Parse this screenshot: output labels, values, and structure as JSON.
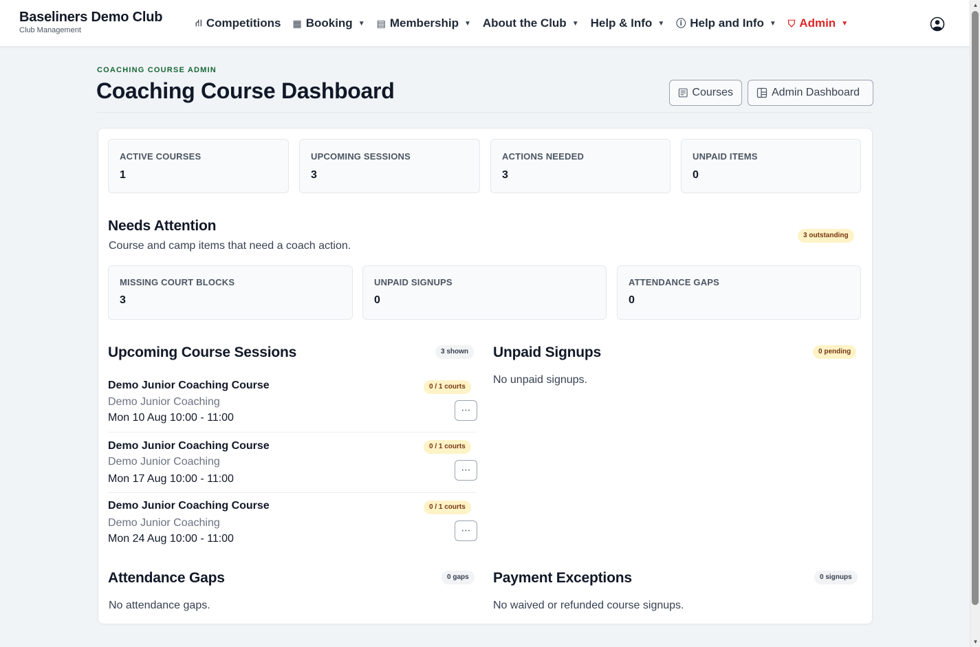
{
  "brand": {
    "name": "Baseliners Demo Club",
    "sub": "Club Management"
  },
  "nav": [
    {
      "label": "Competitions",
      "icon": "sitemap-icon",
      "glyph": "⛙",
      "caret": false
    },
    {
      "label": "Booking",
      "icon": "calendar-icon",
      "glyph": "▦",
      "caret": true
    },
    {
      "label": "Membership",
      "icon": "id-card-icon",
      "glyph": "▤",
      "caret": true
    },
    {
      "label": "About the Club",
      "icon": "",
      "glyph": "",
      "caret": true
    },
    {
      "label": "Help & Info",
      "icon": "",
      "glyph": "",
      "caret": true
    },
    {
      "label": "Help and Info",
      "icon": "info-circle-icon",
      "glyph": "ⓘ",
      "caret": true
    },
    {
      "label": "Admin",
      "icon": "shield-icon",
      "glyph": "⛉",
      "caret": true
    }
  ],
  "colors": {
    "accent_green": "#166534",
    "admin_red": "#dc2626",
    "badge_yellow": "#fef3c7"
  },
  "header": {
    "eyebrow": "COACHING COURSE ADMIN",
    "title": "Coaching Course Dashboard",
    "courses_button": "Courses",
    "admin_dashboard_button": "Admin Dashboard"
  },
  "stats": [
    {
      "label": "ACTIVE COURSES",
      "value": "1"
    },
    {
      "label": "UPCOMING SESSIONS",
      "value": "3"
    },
    {
      "label": "ACTIONS NEEDED",
      "value": "3"
    },
    {
      "label": "UNPAID ITEMS",
      "value": "0"
    }
  ],
  "needs_attention": {
    "title": "Needs Attention",
    "description": "Course and camp items that need a coach action.",
    "badge": "3 outstanding",
    "items": [
      {
        "label": "MISSING COURT BLOCKS",
        "value": "3"
      },
      {
        "label": "UNPAID SIGNUPS",
        "value": "0"
      },
      {
        "label": "ATTENDANCE GAPS",
        "value": "0"
      }
    ]
  },
  "upcoming_sessions": {
    "title": "Upcoming Course Sessions",
    "badge": "3 shown",
    "sessions": [
      {
        "name": "Demo Junior Coaching Course",
        "sub": "Demo Junior Coaching",
        "time": "Mon 10 Aug 10:00 - 11:00",
        "courts": "0 / 1 courts"
      },
      {
        "name": "Demo Junior Coaching Course",
        "sub": "Demo Junior Coaching",
        "time": "Mon 17 Aug 10:00 - 11:00",
        "courts": "0 / 1 courts"
      },
      {
        "name": "Demo Junior Coaching Course",
        "sub": "Demo Junior Coaching",
        "time": "Mon 24 Aug 10:00 - 11:00",
        "courts": "0 / 1 courts"
      }
    ]
  },
  "unpaid_signups": {
    "title": "Unpaid Signups",
    "badge": "0 pending",
    "empty": "No unpaid signups."
  },
  "attendance_gaps": {
    "title": "Attendance Gaps",
    "badge": "0 gaps",
    "empty": "No attendance gaps."
  },
  "payment_exceptions": {
    "title": "Payment Exceptions",
    "badge": "0 signups",
    "empty": "No waived or refunded course signups."
  }
}
